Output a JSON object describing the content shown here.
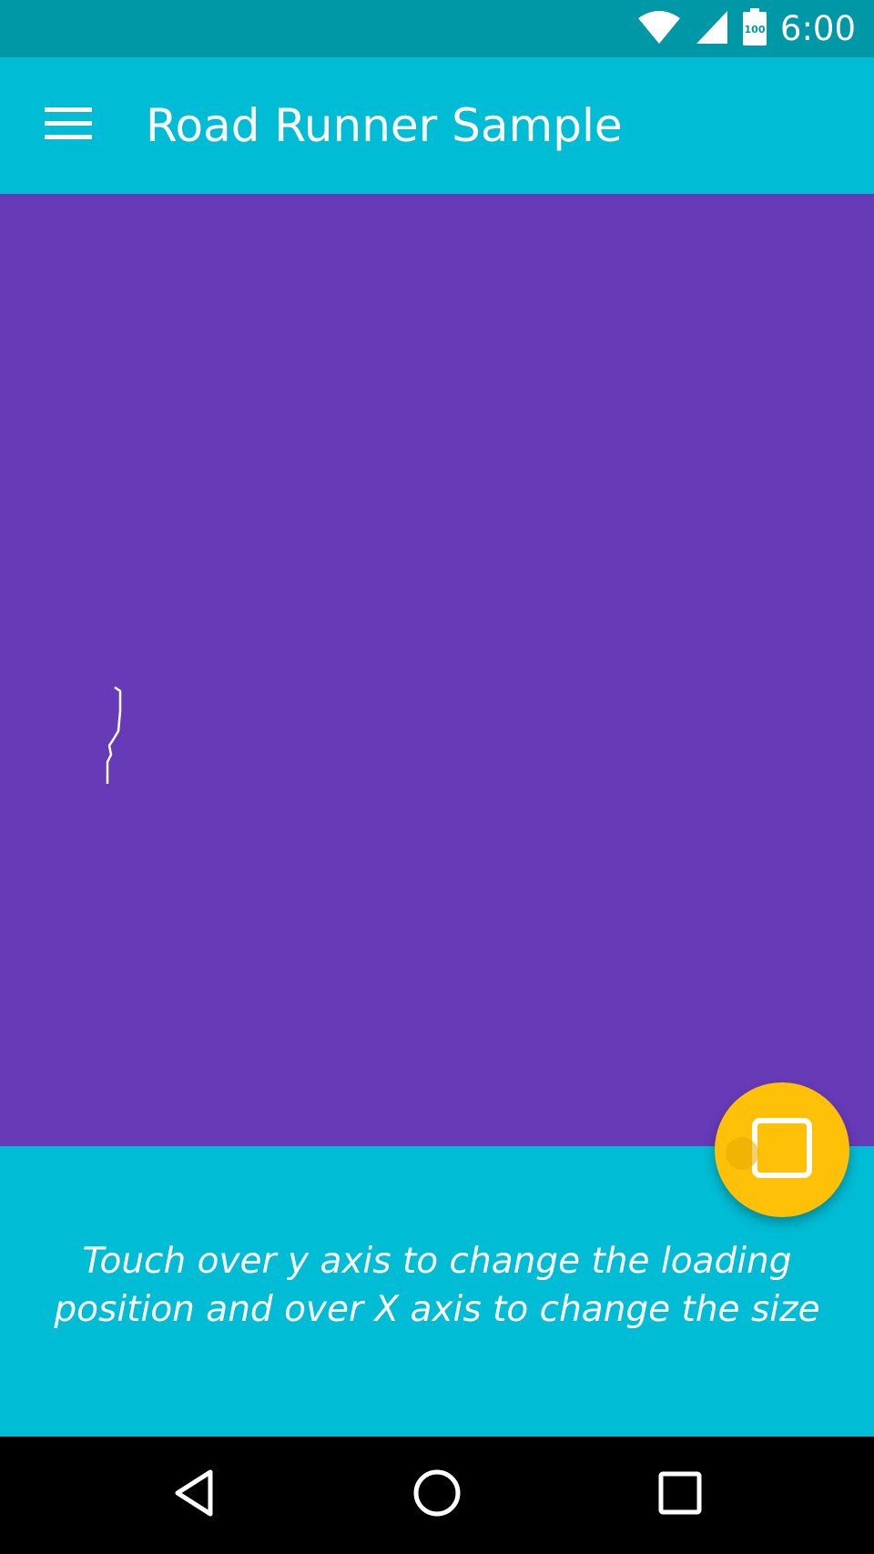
{
  "status_bar": {
    "time": "6:00",
    "battery_level": "100",
    "icons": [
      "wifi-icon",
      "cellular-signal-icon",
      "battery-icon"
    ]
  },
  "app_bar": {
    "title": "Road Runner Sample",
    "menu_icon": "hamburger-menu-icon"
  },
  "canvas": {
    "loader_icon": "loading-trail"
  },
  "bottom_panel": {
    "hint_line1": "Touch over y axis to change the loading",
    "hint_line2": "position and over X axis to change the size"
  },
  "fab": {
    "icon": "stop-square-icon"
  },
  "nav_bar": {
    "buttons": [
      "back-icon",
      "home-icon",
      "recents-icon"
    ]
  },
  "colors": {
    "status_bar": "#0097A7",
    "primary": "#00BCD4",
    "canvas": "#673AB7",
    "accent": "#FFC107",
    "nav_bar": "#000000"
  }
}
